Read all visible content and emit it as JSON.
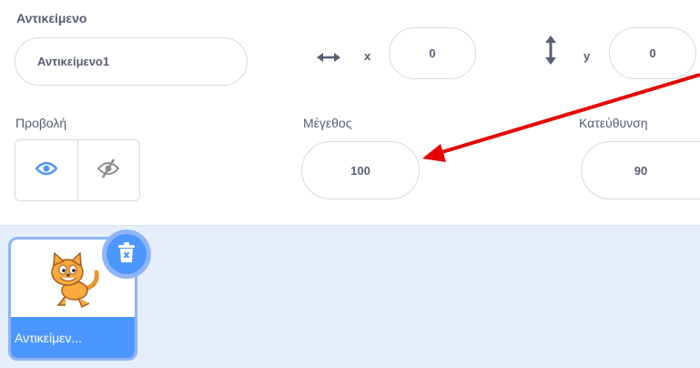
{
  "sprite_info": {
    "sprite_label": "Αντικείμενο",
    "sprite_name_value": "Αντικείμενο1",
    "x_label": "x",
    "x_value": "0",
    "y_label": "y",
    "y_value": "0",
    "show_label": "Προβολή",
    "size_label": "Μέγεθος",
    "size_value": "100",
    "direction_label": "Κατεύθυνση",
    "direction_value": "90"
  },
  "sprite_list": {
    "items": [
      {
        "name": "Αντικείμεν..."
      }
    ]
  },
  "colors": {
    "accent": "#4c97ff",
    "accent_light": "#8fb5f6",
    "text": "#575e75",
    "pane_bg": "#e6eefc",
    "annotation_arrow": "#e60000"
  },
  "icons": [
    "horizontal-arrow-icon",
    "vertical-arrow-icon",
    "eye-icon",
    "eye-off-icon",
    "trash-icon",
    "cat-sprite-icon"
  ]
}
